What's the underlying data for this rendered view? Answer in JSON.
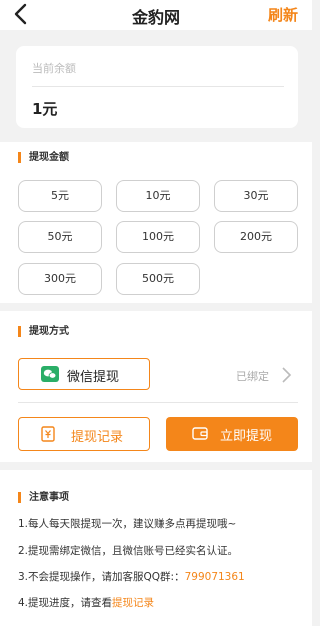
{
  "header": {
    "title": "金豹网",
    "refresh_label": "刷新"
  },
  "balance": {
    "label": "当前余额",
    "value": "1元"
  },
  "amount_section": {
    "title": "提现金额",
    "options": [
      "5元",
      "10元",
      "30元",
      "50元",
      "100元",
      "200元",
      "300元",
      "500元"
    ]
  },
  "method_section": {
    "title": "提现方式",
    "method_label": "微信提现",
    "bound_label": "已绑定"
  },
  "actions": {
    "record_label": "提现记录",
    "withdraw_label": "立即提现"
  },
  "notes": {
    "title": "注意事项",
    "line1": "1.每人每天限提现一次，建议赚多点再提现哦~",
    "line2": "2.提现需绑定微信，且微信账号已经实名认证。",
    "line3_prefix": "3.不会提现操作，请加客服QQ群:：",
    "line3_qq": "799071361",
    "line4_prefix": "4.提现进度，请查看",
    "line4_link": "提现记录"
  },
  "colors": {
    "accent": "#f4861a",
    "wechat": "#2aae67"
  },
  "icons": [
    "back-arrow-icon",
    "wechat-icon",
    "chevron-right-icon",
    "record-icon",
    "wallet-icon"
  ]
}
